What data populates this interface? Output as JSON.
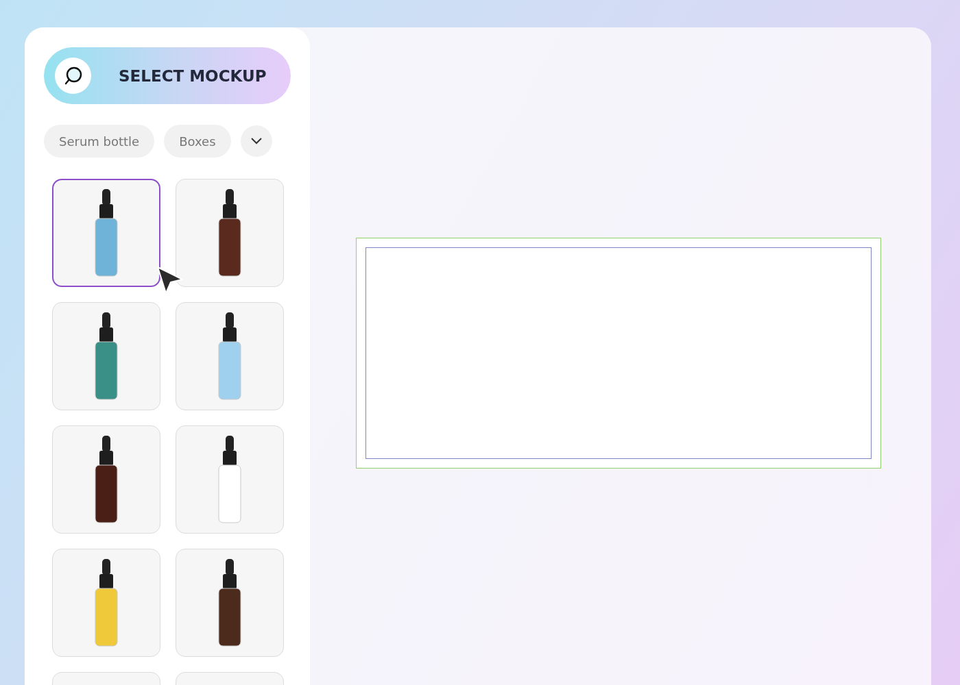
{
  "select_button": {
    "label": "SELECT MOCKUP"
  },
  "filters": [
    {
      "label": "Serum bottle"
    },
    {
      "label": "Boxes"
    }
  ],
  "mockups": [
    {
      "selected": true,
      "color": "#6fb3d8"
    },
    {
      "selected": false,
      "color": "#5a2a1e"
    },
    {
      "selected": false,
      "color": "#3a8f86"
    },
    {
      "selected": false,
      "color": "#9fd0ee"
    },
    {
      "selected": false,
      "color": "#4a1f16"
    },
    {
      "selected": false,
      "color": "#ffffff"
    },
    {
      "selected": false,
      "color": "#f0c93a"
    },
    {
      "selected": false,
      "color": "#4c2a1c"
    },
    {
      "selected": false
    },
    {
      "selected": false
    }
  ]
}
